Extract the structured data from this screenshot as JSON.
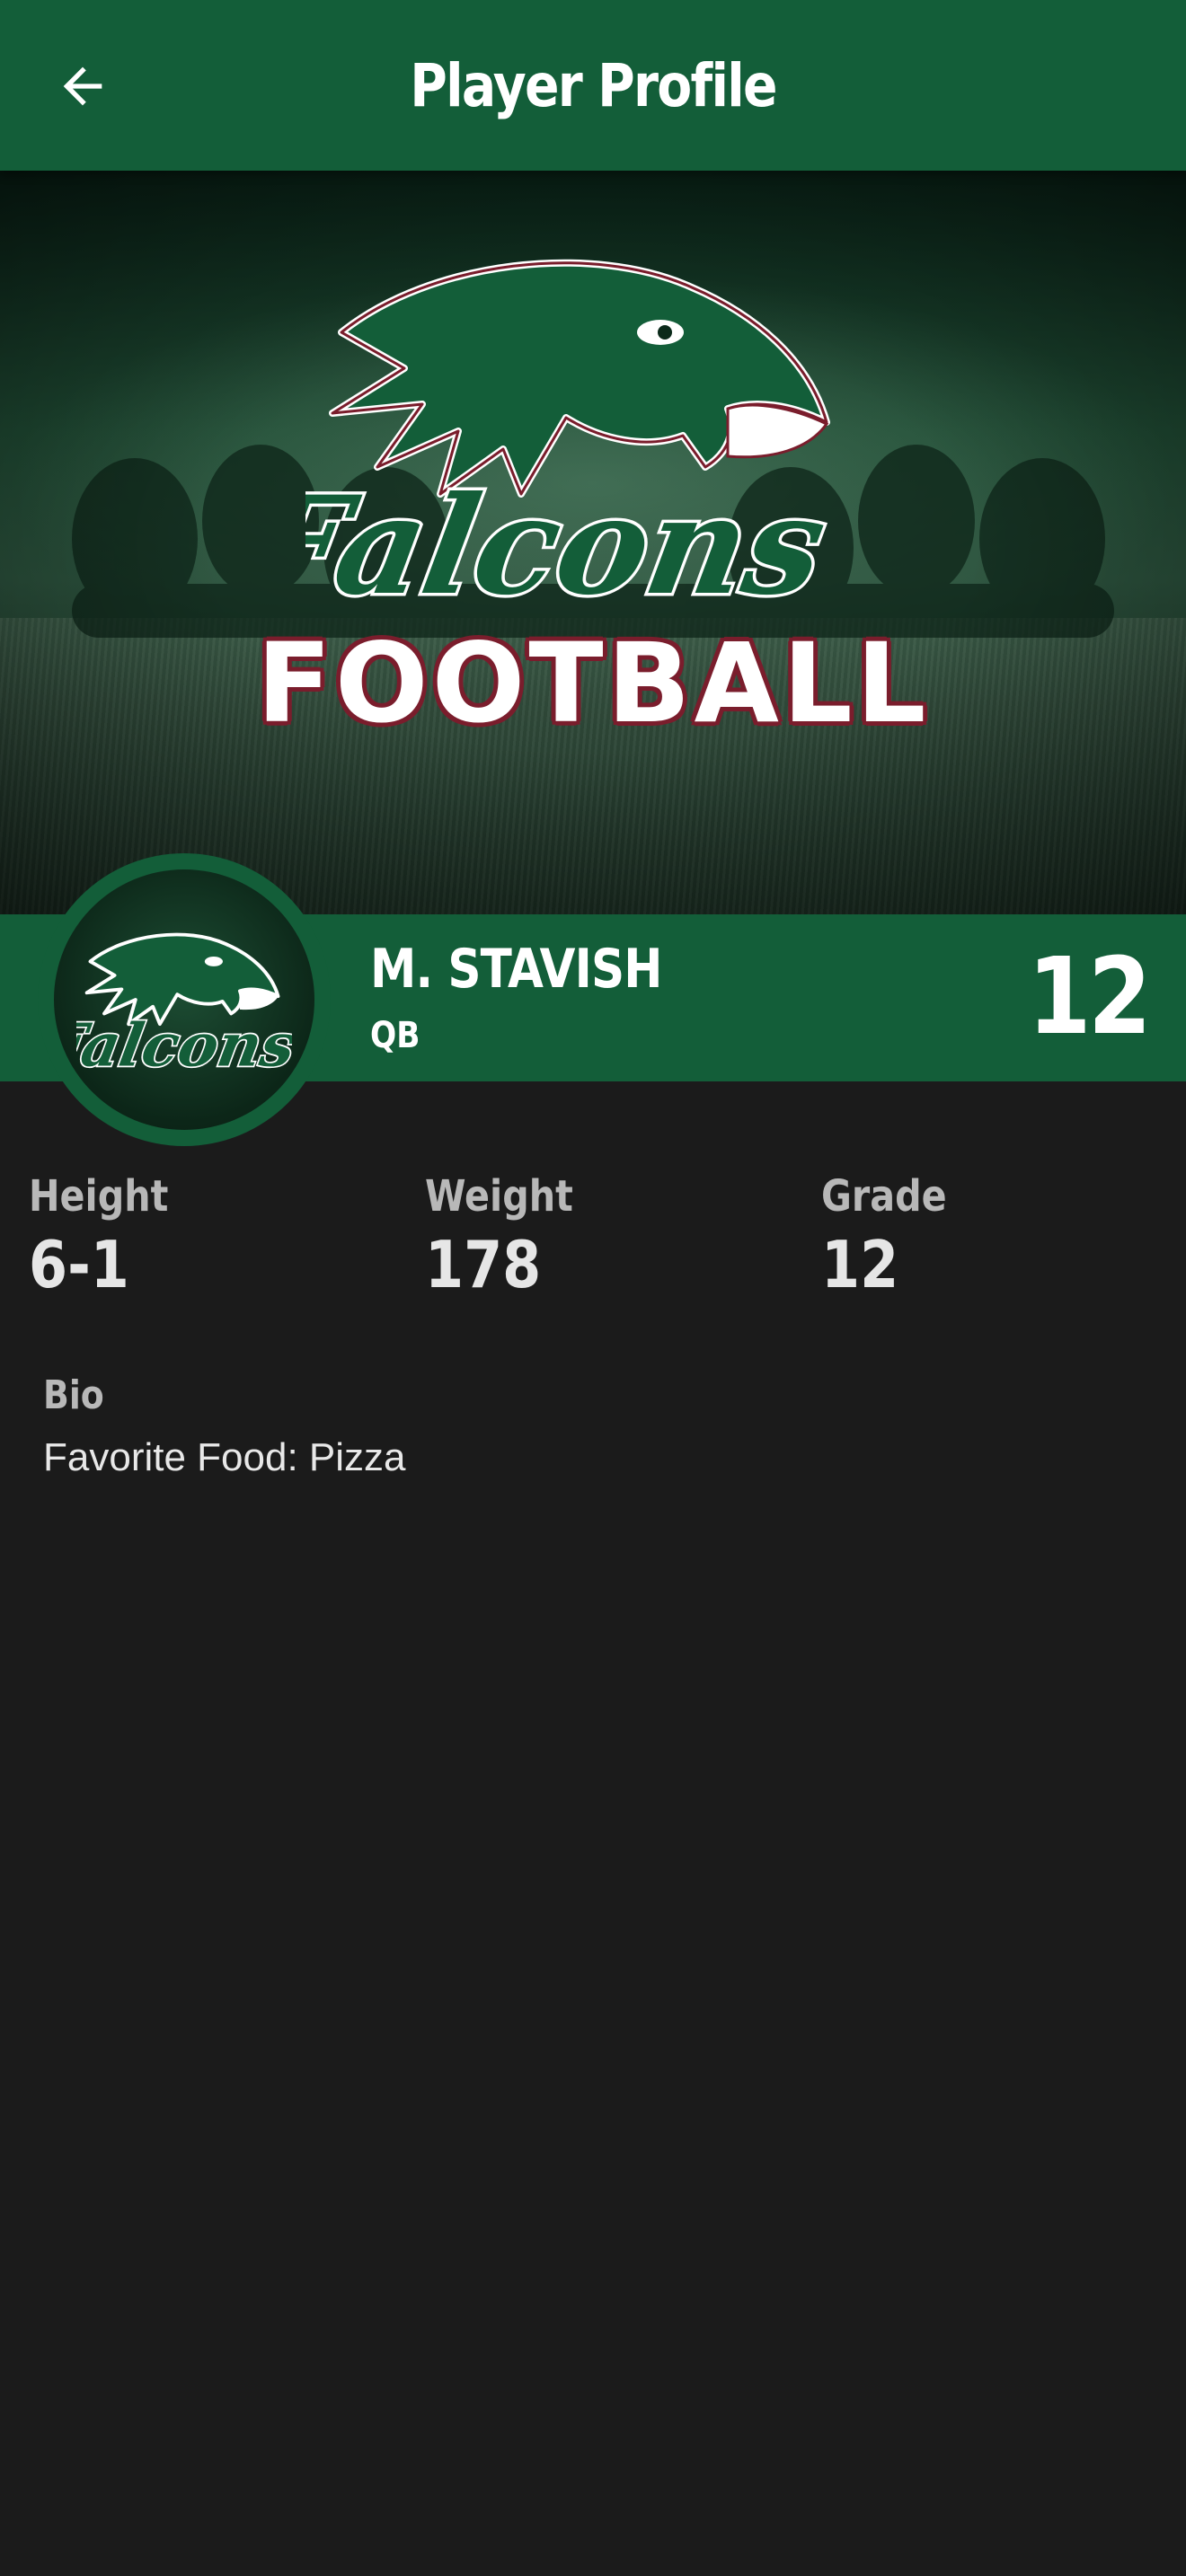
{
  "header": {
    "title": "Player Profile",
    "back_icon": "arrow-left-icon"
  },
  "hero": {
    "logo_text": "Falcons",
    "banner_text": "FOOTBALL",
    "colors": {
      "green": "#135e39",
      "maroon": "#7a1d2c"
    }
  },
  "player": {
    "name": "M. STAVISH",
    "position": "QB",
    "number": "12"
  },
  "stats": [
    {
      "label": "Height",
      "value": "6-1"
    },
    {
      "label": "Weight",
      "value": "178"
    },
    {
      "label": "Grade",
      "value": "12"
    }
  ],
  "bio": {
    "label": "Bio",
    "text": "Favorite Food: Pizza"
  }
}
